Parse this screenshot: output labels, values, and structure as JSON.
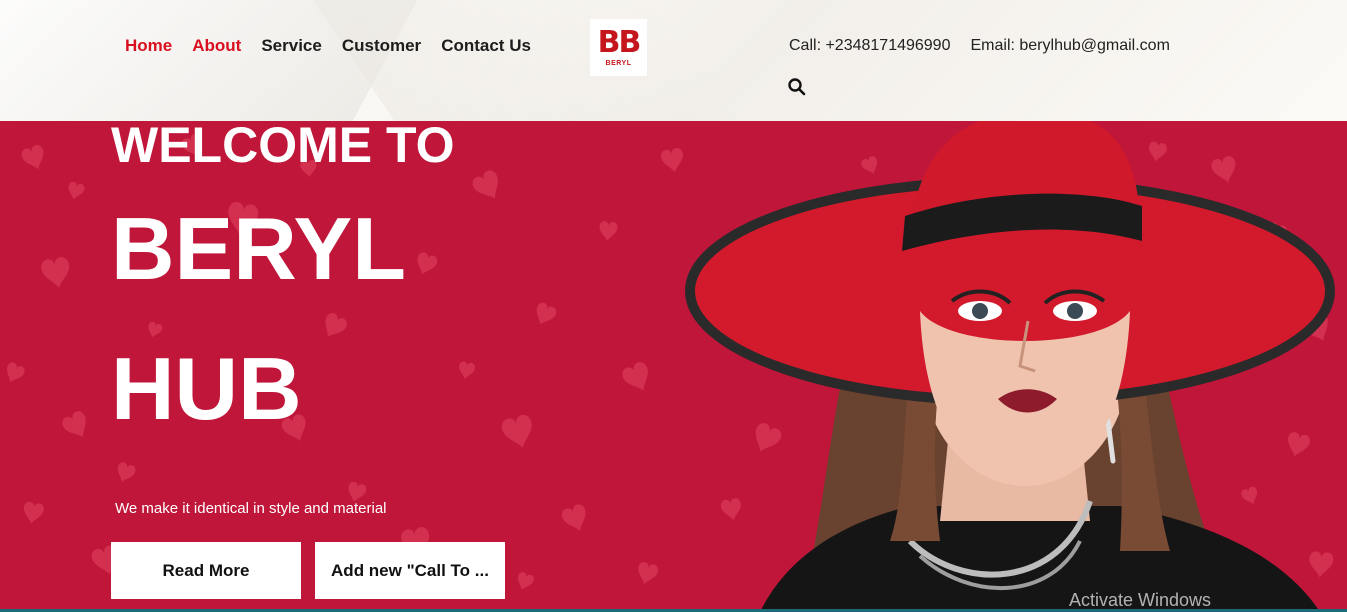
{
  "nav": {
    "items": [
      {
        "label": "Home",
        "active": true
      },
      {
        "label": "About",
        "active": true
      },
      {
        "label": "Service",
        "active": false
      },
      {
        "label": "Customer",
        "active": false
      },
      {
        "label": "Contact Us",
        "active": false
      }
    ]
  },
  "logo": {
    "mark": "BB",
    "word": "BERYL"
  },
  "contact": {
    "phone": "Call: +2348171496990",
    "email": "Email: berylhub@gmail.com"
  },
  "search": {
    "icon": "search-icon"
  },
  "hero": {
    "welcome": "WELCOME TO",
    "brand_line1": "BERYL",
    "brand_line2": "HUB",
    "tagline": "We make it identical in style and material",
    "read_more": "Read More",
    "cta": "Add new \"Call To ..."
  },
  "system": {
    "watermark": "Activate Windows"
  },
  "colors": {
    "accent": "#d9101f",
    "hero_bg": "#c0163a",
    "hat": "#d21a2c",
    "text_dark": "#1d1d1d"
  }
}
